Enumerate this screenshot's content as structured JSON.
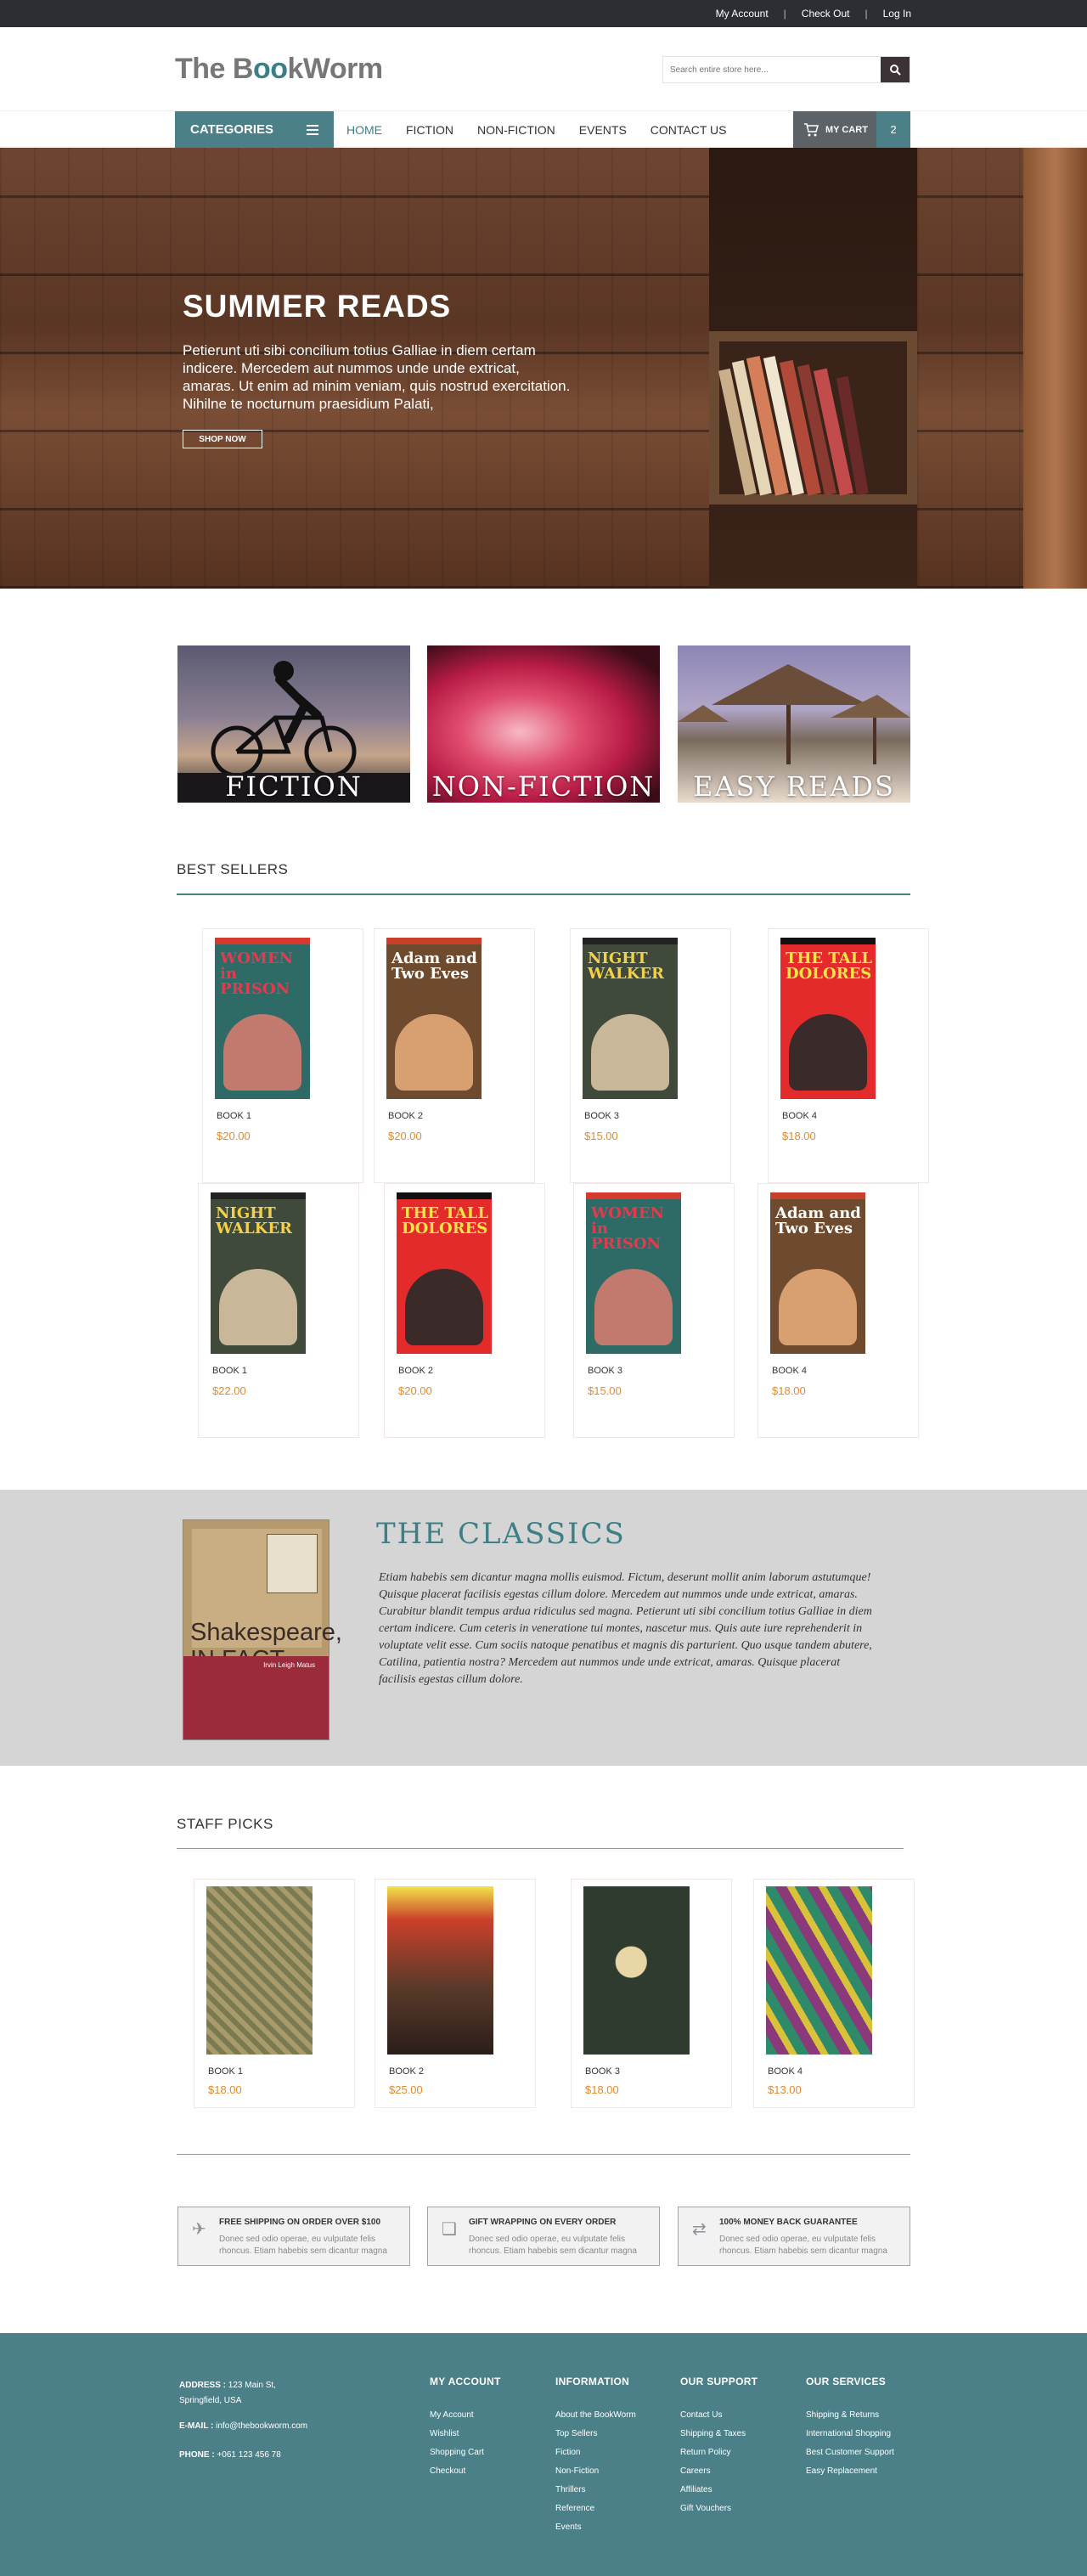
{
  "topbar": {
    "links": [
      "My Account",
      "Check Out",
      "Log In"
    ],
    "sep": "|"
  },
  "header": {
    "logo_a": "The B",
    "logo_oo": "oo",
    "logo_b": "kWorm",
    "search_placeholder": "Search entire store here..."
  },
  "nav": {
    "categories_label": "CATEGORIES",
    "links": [
      "HOME",
      "FICTION",
      "NON-FICTION",
      "EVENTS",
      "CONTACT US"
    ],
    "cart_label": "MY CART",
    "cart_count": "2"
  },
  "hero": {
    "title": "SUMMER READS",
    "text": "Petierunt uti sibi concilium totius Galliae in diem certam indicere. Mercedem aut nummos unde unde extricat, amaras. Ut enim ad minim veniam, quis nostrud exercitation. Nihilne te nocturnum praesidium Palati,",
    "button": "SHOP NOW"
  },
  "categories": [
    "FICTION",
    "NON-FICTION",
    "EASY READS"
  ],
  "best_sellers": {
    "title": "BEST SELLERS",
    "items": [
      {
        "name": "BOOK 1",
        "price": "$20.00",
        "cover": "WOMEN in PRISON"
      },
      {
        "name": "BOOK 2",
        "price": "$20.00",
        "cover": "Adam and Two Eves"
      },
      {
        "name": "BOOK 3",
        "price": "$15.00",
        "cover": "NIGHT WALKER"
      },
      {
        "name": "BOOK 4",
        "price": "$18.00",
        "cover": "THE TALL DOLORES"
      },
      {
        "name": "BOOK 1",
        "price": "$22.00",
        "cover": "NIGHT WALKER"
      },
      {
        "name": "BOOK 2",
        "price": "$20.00",
        "cover": "THE TALL DOLORES"
      },
      {
        "name": "BOOK 3",
        "price": "$15.00",
        "cover": "WOMEN in PRISON"
      },
      {
        "name": "BOOK 4",
        "price": "$18.00",
        "cover": "Adam and Two Eves"
      }
    ]
  },
  "classics": {
    "title": "THE CLASSICS",
    "book_title": "Shakespeare, IN FACT",
    "book_author": "Irvin Leigh Matus",
    "text": "Etiam habebis sem dicantur magna mollis euismod. Fictum,  deserunt mollit anim laborum astutumque! Quisque placerat facilisis egestas cillum dolore. Mercedem aut nummos unde unde extricat, amaras. Curabitur blandit tempus ardua ridiculus sed magna. Petierunt uti sibi concilium totius Galliae in diem certam indicere. Cum ceteris in veneratione tui montes, nascetur mus. Quis aute iure reprehenderit in voluptate velit esse. Cum sociis natoque penatibus et magnis dis parturient. Quo usque tandem abutere, Catilina, patientia nostra? Mercedem aut nummos unde unde extricat, amaras. Quisque placerat facilisis egestas cillum dolore."
  },
  "staff_picks": {
    "title": "STAFF PICKS",
    "items": [
      {
        "name": "BOOK 1",
        "price": "$18.00"
      },
      {
        "name": "BOOK 2",
        "price": "$25.00"
      },
      {
        "name": "BOOK 3",
        "price": "$18.00"
      },
      {
        "name": "BOOK 4",
        "price": "$13.00"
      }
    ]
  },
  "features": [
    {
      "icon": "plane-icon",
      "title": "FREE SHIPPING ON ORDER OVER $100",
      "desc": "Donec sed odio operae, eu vulputate felis rhoncus. Etiam habebis sem dicantur magna"
    },
    {
      "icon": "gift-icon",
      "title": "GIFT WRAPPING ON EVERY ORDER",
      "desc": "Donec sed odio operae, eu vulputate felis rhoncus. Etiam habebis sem dicantur magna"
    },
    {
      "icon": "exchange-icon",
      "title": "100% MONEY BACK GUARANTEE",
      "desc": "Donec sed odio operae, eu vulputate felis rhoncus. Etiam habebis sem dicantur magna"
    }
  ],
  "footer": {
    "address_label": "ADDRESS :",
    "address_1": "123 Main St,",
    "address_2": "Springfield, USA",
    "email_label": "E-MAIL :",
    "email": "info@thebookworm.com",
    "phone_label": "PHONE :",
    "phone": "+061 123 456 78",
    "columns": [
      {
        "title": "MY ACCOUNT",
        "items": [
          "My Account",
          "Wishlist",
          "Shopping Cart",
          "Checkout"
        ]
      },
      {
        "title": "INFORMATION",
        "items": [
          "About the BookWorm",
          "Top Sellers",
          "Fiction",
          "Non-Fiction",
          "Thrillers",
          "Reference",
          "Events"
        ]
      },
      {
        "title": "OUR SUPPORT",
        "items": [
          "Contact Us",
          "Shipping & Taxes",
          "Return Policy",
          "Careers",
          "Affiliates",
          "Gift Vouchers"
        ]
      },
      {
        "title": "OUR SERVICES",
        "items": [
          "Shipping & Returns",
          "International Shopping",
          "Best Customer Support",
          "Easy Replacement"
        ]
      }
    ]
  },
  "colors": {
    "accent": "#4b8088",
    "price": "#e38a2b",
    "topbar": "#2b2f33",
    "classics_bg": "#d5d5d5"
  }
}
